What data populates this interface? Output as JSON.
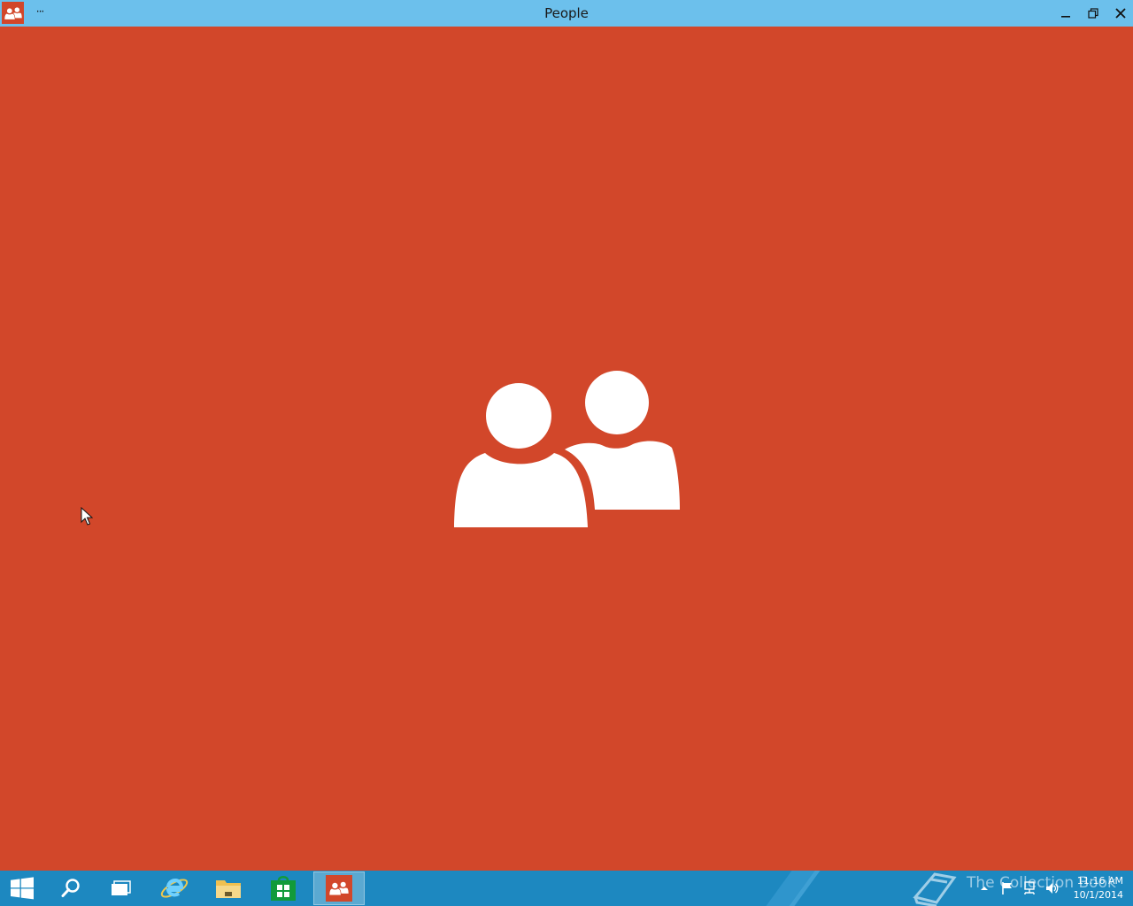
{
  "window": {
    "title": "People",
    "menu_label": "···",
    "icons": {
      "app": "people-icon",
      "minimize": "minimize-icon",
      "maximize": "restore-icon",
      "close": "close-icon"
    }
  },
  "splash": {
    "icon": "people-icon",
    "background_color": "#d2472a",
    "foreground_color": "#ffffff"
  },
  "taskbar": {
    "background_color": "#1d88c0",
    "items": [
      {
        "name": "start",
        "icon": "windows-logo-icon"
      },
      {
        "name": "search",
        "icon": "search-icon"
      },
      {
        "name": "task-view",
        "icon": "task-view-icon"
      },
      {
        "name": "internet-explorer",
        "icon": "internet-explorer-icon"
      },
      {
        "name": "file-explorer",
        "icon": "folder-icon"
      },
      {
        "name": "store",
        "icon": "store-icon"
      },
      {
        "name": "people",
        "icon": "people-icon",
        "active": true
      }
    ],
    "tray": {
      "icons": [
        "chevron-up-icon",
        "flag-icon",
        "network-icon",
        "volume-icon"
      ],
      "time": "11:16 AM",
      "date": "10/1/2014"
    },
    "watermark": "The Collection Book"
  }
}
